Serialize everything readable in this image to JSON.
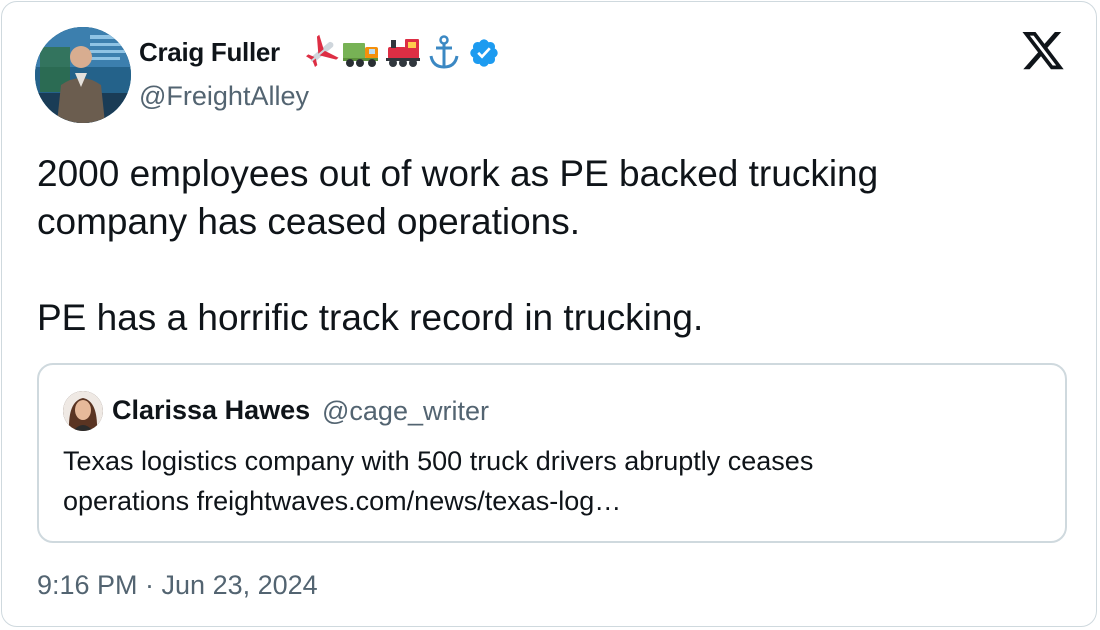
{
  "author": {
    "display_name": "Craig Fuller",
    "handle": "@FreightAlley",
    "badge_emojis": [
      "airplane-icon",
      "truck-icon",
      "train-icon",
      "anchor-icon"
    ],
    "verified": true,
    "verified_color": "#1d9bf0"
  },
  "tweet": {
    "text_lines": [
      "2000 employees out of work as PE backed trucking",
      "company has ceased operations.",
      "PE has a horrific track record in trucking."
    ],
    "timestamp": "9:16 PM · Jun 23, 2024"
  },
  "quoted_tweet": {
    "display_name": "Clarissa Hawes",
    "handle": "@cage_writer",
    "text_lines": [
      "Texas logistics company with 500 truck drivers abruptly ceases",
      "operations freightwaves.com/news/texas-log…"
    ]
  },
  "brand": {
    "logo": "x-logo-icon"
  },
  "colors": {
    "text": "#0f1419",
    "secondary_text": "#536471",
    "border": "#cfd9de"
  }
}
